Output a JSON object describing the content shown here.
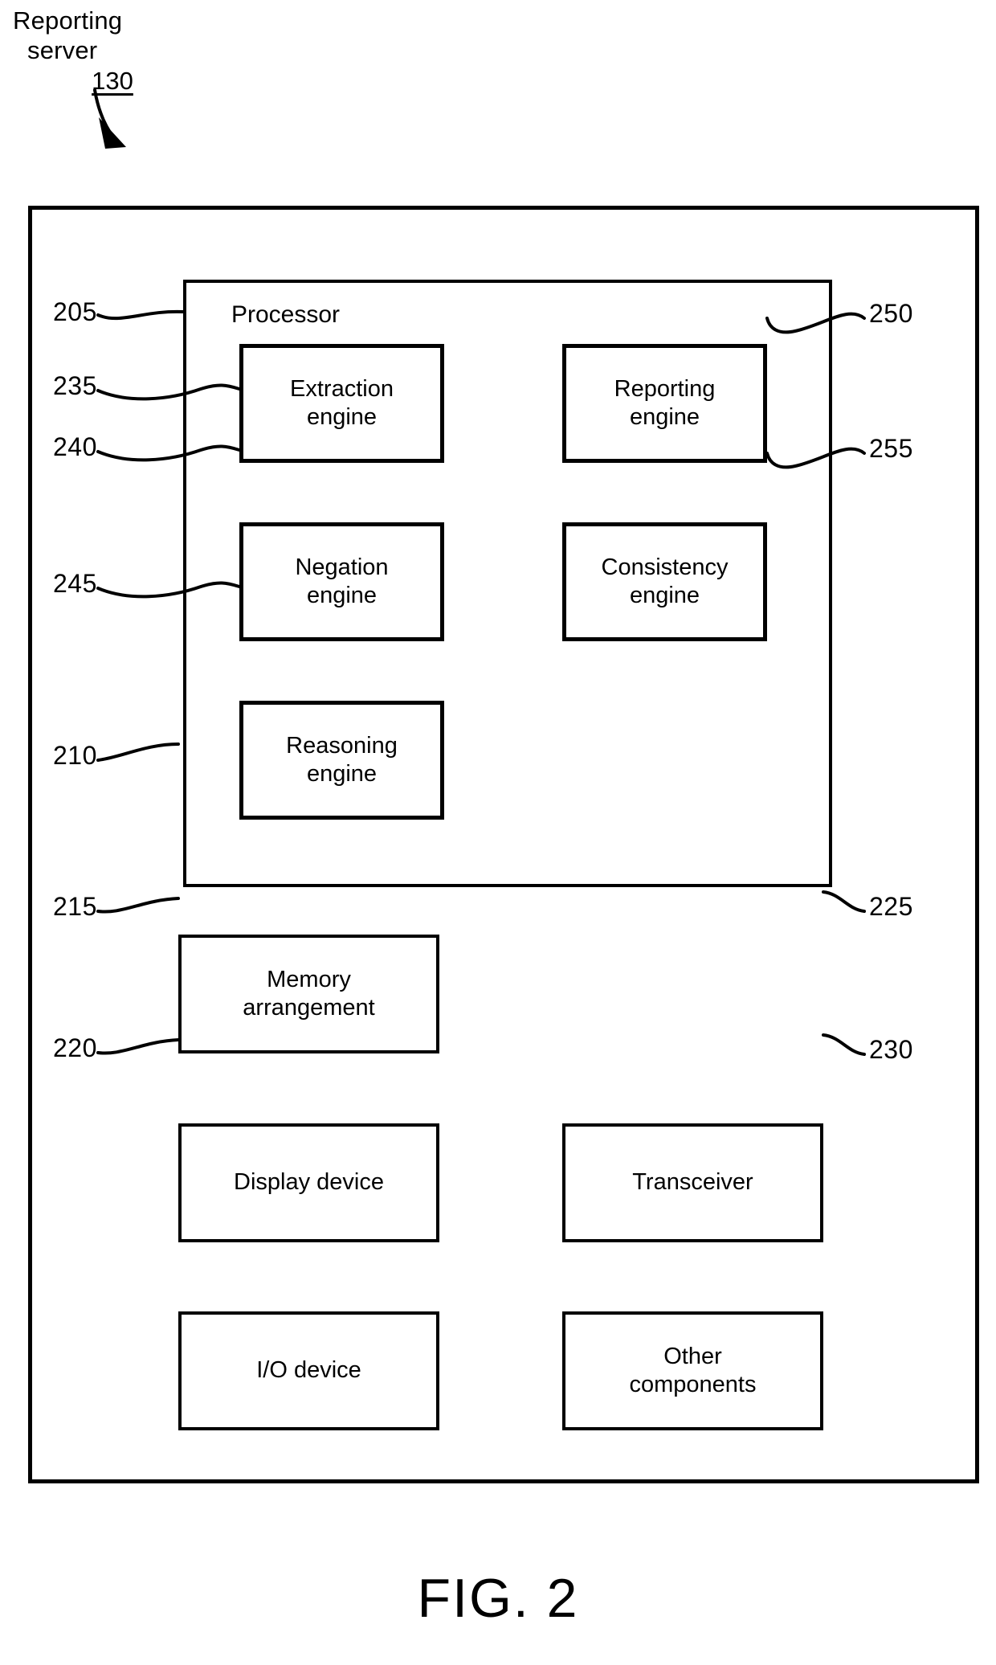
{
  "figure": {
    "label": "FIG. 2",
    "callout": {
      "title_line1": "Reporting",
      "title_line2": "server",
      "ref": "130"
    }
  },
  "device": {
    "processor": {
      "title": "Processor",
      "ref": "205",
      "engines": [
        {
          "ref": "235",
          "line1": "Extraction",
          "line2": "engine",
          "side": "left"
        },
        {
          "ref": "250",
          "line1": "Reporting",
          "line2": "engine",
          "side": "right"
        },
        {
          "ref": "240",
          "line1": "Negation",
          "line2": "engine",
          "side": "left"
        },
        {
          "ref": "255",
          "line1": "Consistency",
          "line2": "engine",
          "side": "right"
        },
        {
          "ref": "245",
          "line1": "Reasoning",
          "line2": "engine",
          "side": "left"
        }
      ]
    },
    "components": [
      {
        "ref": "210",
        "line1": "Memory",
        "line2": "arrangement",
        "side": "left"
      },
      {
        "ref": "215",
        "line1": "Display device",
        "line2": "",
        "side": "left"
      },
      {
        "ref": "225",
        "line1": "Transceiver",
        "line2": "",
        "side": "right"
      },
      {
        "ref": "220",
        "line1": "I/O device",
        "line2": "",
        "side": "left"
      },
      {
        "ref": "230",
        "line1": "Other",
        "line2": "components",
        "side": "right"
      }
    ]
  },
  "style": {
    "line_color": "#000000",
    "fill_color": "#ffffff"
  }
}
